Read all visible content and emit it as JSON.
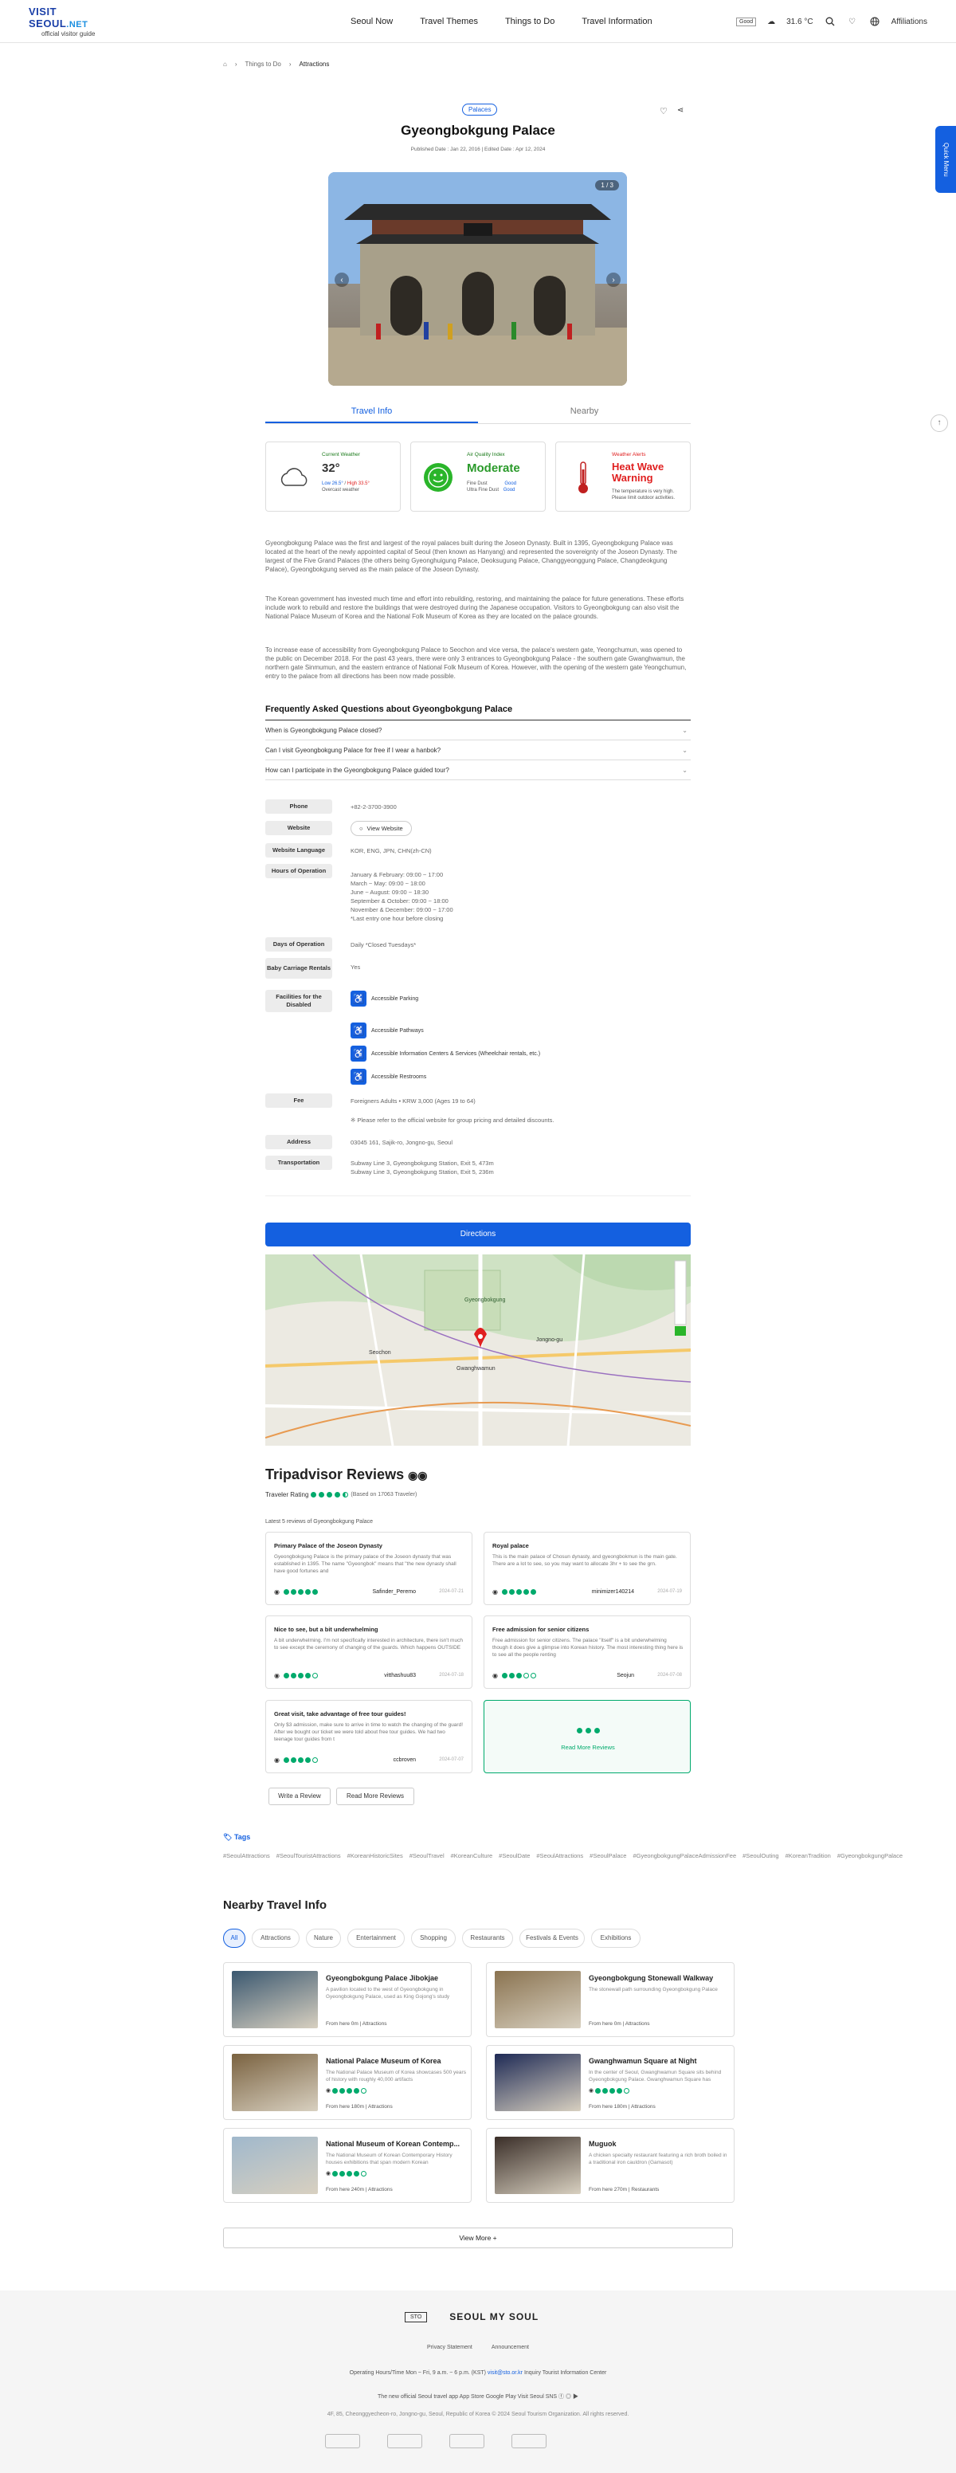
{
  "header": {
    "logo_main": "VISIT SEOUL",
    "logo_net": ".NET",
    "logo_sub": "official visitor guide",
    "nav": [
      "Seoul Now",
      "Travel Themes",
      "Things to Do",
      "Travel Information"
    ],
    "air_label": "Good",
    "temp": "31.6 °C",
    "affiliations": "Affiliations"
  },
  "breadcrumb": [
    "Things to Do",
    "Attractions"
  ],
  "category": "Palaces",
  "title": "Gyeongbokgung Palace",
  "dates": "Published Date : Jan 22, 2016 | Edited Date : Apr 12, 2024",
  "photo_counter": "1 / 3",
  "tabs": [
    "Travel Info",
    "Nearby"
  ],
  "weather": {
    "cur_label": "Current Weather",
    "cur_temp": "32°",
    "cur_low": "Low 26.5°",
    "cur_high": "High 33.5°",
    "cur_desc": "Overcast weather",
    "air_label": "Air Quality Index",
    "air_value": "Moderate",
    "air_fine": "Fine Dust",
    "air_fine_v": "Good",
    "air_ultra": "Ultra Fine Dust",
    "air_ultra_v": "Good",
    "warn_label": "Weather Alerts",
    "warn_value": "Heat Wave Warning",
    "warn_desc": "The temperature is very high. Please limit outdoor activities."
  },
  "desc": [
    "Gyeongbokgung Palace was the first and largest of the royal palaces built during the Joseon Dynasty. Built in 1395, Gyeongbokgung Palace was located at the heart of the newly appointed capital of Seoul (then known as Hanyang) and represented the sovereignty of the Joseon Dynasty. The largest of the Five Grand Palaces (the others being Gyeonghuigung Palace, Deoksugung Palace, Changgyeonggung Palace, Changdeokgung Palace), Gyeongbokgung served as the main palace of the Joseon Dynasty.",
    "The Korean government has invested much time and effort into rebuilding, restoring, and maintaining the palace for future generations. These efforts include work to rebuild and restore the buildings that were destroyed during the Japanese occupation. Visitors to Gyeongbokgung can also visit the National Palace Museum of Korea and the National Folk Museum of Korea as they are located on the palace grounds.",
    "To increase ease of accessibility from Gyeongbokgung Palace to Seochon and vice versa, the palace's western gate, Yeongchumun, was opened to the public on December 2018. For the past 43 years, there were only 3 entrances to Gyeongbokgung Palace - the southern gate Gwanghwamun, the northern gate Sinmumun, and the eastern entrance of National Folk Museum of Korea. However, with the opening of the western gate Yeongchumun, entry to the palace from all directions has been now made possible."
  ],
  "faq": {
    "heading": "Frequently Asked Questions about Gyeongbokgung Palace",
    "items": [
      "When is Gyeongbokgung Palace closed?",
      "Can I visit Gyeongbokgung Palace for free if I wear a hanbok?",
      "How can I participate in the Gyeongbokgung Palace guided tour?"
    ]
  },
  "info": {
    "phone_l": "Phone",
    "phone": "+82-2-3700-3900",
    "web_l": "Website",
    "web": "View Website",
    "lang_l": "Website Language",
    "lang": "KOR, ENG, JPN, CHN(zh-CN)",
    "hours_l": "Hours of Operation",
    "hours": [
      "January & February: 09:00 ~ 17:00",
      "March ~ May: 09:00 ~ 18:00",
      "June ~ August: 09:00 ~ 18:30",
      "September & October: 09:00 ~ 18:00",
      "November & December: 09:00 ~ 17:00",
      "*Last entry one hour before closing"
    ],
    "days_l": "Days of Operation",
    "days": "Daily *Closed Tuesdays*",
    "baby_l": "Baby Carriage Rentals",
    "baby": "Yes",
    "fac_l": "Facilities for the Disabled",
    "fac": [
      "Accessible Parking",
      "Accessible Pathways",
      "Accessible Information Centers & Services (Wheelchair rentals, etc.)",
      "Accessible Restrooms"
    ],
    "fee_l": "Fee",
    "fee": "Foreigners Adults • KRW 3,000 (Ages 19 to 64)",
    "fee_note": "※ Please refer to the official website for group pricing and detailed discounts.",
    "addr_l": "Address",
    "addr": "03045  161, Sajik-ro, Jongno-gu, Seoul",
    "trans_l": "Transportation",
    "trans": [
      "Subway Line 3, Gyeongbokgung Station, Exit 5, 473m",
      "Subway Line 3, Gyeongbokgung Station, Exit 5, 236m"
    ]
  },
  "directions": "Directions",
  "map_labels": [
    "Gyeongbokgung",
    "Gwanghwamun",
    "Jongno-gu",
    "Seochon"
  ],
  "trip": {
    "heading": "Tripadvisor Reviews",
    "rating_label": "Traveler Rating",
    "based": "(Based on 17063 Traveler)",
    "latest": "Latest 5 reviews of Gyeongbokgung Palace",
    "reviews": [
      {
        "t": "Primary Palace of the Joseon Dynasty",
        "b": "Gyeongbokgung Palace is the primary palace of the Joseon dynasty that was established in 1395. The name \"Gyeongbok\" means that \"the new dynasty shall have good fortunes and",
        "n": "Safinder_Peremo",
        "d": "2024-07-21",
        "r": 5
      },
      {
        "t": "Royal palace",
        "b": "This is the main palace of Chosun dynasty, and gyeongbokmun is the main gate. There are a lot to see, so you may want to allocate 3hr + to see the grn.",
        "n": "minimizer140214",
        "d": "2024-07-19",
        "r": 5
      },
      {
        "t": "Nice to see, but a bit underwhelming",
        "b": "A bit underwhelming. I'm not specifically interested in architecture, there isn't much to see except the ceremony of changing of the guards. Which happens OUTSIDE",
        "n": "vitthashuu83",
        "d": "2024-07-18",
        "r": 4
      },
      {
        "t": "Free admission for senior citizens",
        "b": "Free admission for senior citizens. The palace \"itself\" is a bit underwhelming though it does give a glimpse into Korean history. The most interesting thing here is to see all the people renting",
        "n": "Seojun",
        "d": "2024-07-08",
        "r": 3
      },
      {
        "t": "Great visit, take advantage of free tour guides!",
        "b": "Only $3 admission, make sure to arrive in time to watch the changing of the guard! After we bought our ticket we were told about free tour guides. We had two teenage tour guides from t",
        "n": "ccbroven",
        "d": "2024-07-07",
        "r": 4
      }
    ],
    "read_more": "Read More Reviews",
    "write": "Write a Review",
    "more_rev": "Read More Reviews"
  },
  "tags": {
    "heading": "Tags",
    "items": [
      "#SeoulAttractions",
      "#SeoulTouristAttractions",
      "#KoreanHistoricSites",
      "#SeoulTravel",
      "#KoreanCulture",
      "#SeoulDate",
      "#SeoulAttractions",
      "#SeoulPalace",
      "#GyeongbokgungPalaceAdmissionFee",
      "#SeoulOuting",
      "#KoreanTradition",
      "#GyeongbokgungPalace"
    ]
  },
  "nearby": {
    "heading": "Nearby Travel Info",
    "filters": [
      "All",
      "Attractions",
      "Nature",
      "Entertainment",
      "Shopping",
      "Restaurants",
      "Festivals & Events",
      "Exhibitions"
    ],
    "cards": [
      {
        "t": "Gyeongbokgung Palace Jibokjae",
        "d": "A pavilion located to the west of Gyeongbokgung in Gyeongbokgung Palace, used as King Gojong's study",
        "m": "From here 0m | Attractions",
        "c": "#3b5870",
        "r": 0
      },
      {
        "t": "Gyeongbokgung Stonewall Walkway",
        "d": "The stonewall path surrounding Gyeongbokgung Palace",
        "m": "From here 0m | Attractions",
        "c": "#8a7350",
        "r": 0
      },
      {
        "t": "National Palace Museum of Korea",
        "d": "The National Palace Museum of Korea showcases 500 years of history with roughly 40,000 artifacts",
        "m": "From here 180m | Attractions",
        "c": "#7a6240",
        "r": 4
      },
      {
        "t": "Gwanghwamun Square at Night",
        "d": "In the center of Seoul, Gwanghwamun Square sits behind Gyeongbokgung Palace. Gwanghwamun Square has",
        "m": "From here 180m | Attractions",
        "c": "#1e2a55",
        "r": 4
      },
      {
        "t": "National Museum of Korean Contemp...",
        "d": "The National Museum of Korean Contemporary History houses exhibitions that span modern Korean",
        "m": "From here 240m | Attractions",
        "c": "#a0b8cc",
        "r": 4
      },
      {
        "t": "Muguok",
        "d": "A chicken specialty restaurant featuring a rich broth boiled in a traditional iron cauldron (Gamasot)",
        "m": "From here 270m | Restaurants",
        "c": "#3a2e28",
        "r": 0
      }
    ],
    "view_more": "View More +"
  },
  "footer": {
    "brand": "SEOUL MY SOUL",
    "privacy": "Privacy Statement",
    "announce": "Announcement",
    "hours": "Operating Hours/Time   Mon ~ Fri, 9 a.m. ~ 6 p.m. (KST)",
    "mail": "visit@sto.or.kr",
    "inquiry": "Inquiry   Tourist Information Center",
    "app": "The new official Seoul travel app   App Store   Google Play",
    "sns": "Visit Seoul SNS",
    "copy": "4F, 85, Cheonggyecheon-ro, Jongno-gu, Seoul, Republic of Korea   © 2024 Seoul Tourism Organization. All rights reserved."
  },
  "quick": "Quick Menu",
  "colors": {
    "accent": "#1460e0",
    "trip": "#00aa6c",
    "warn": "#e02020"
  }
}
